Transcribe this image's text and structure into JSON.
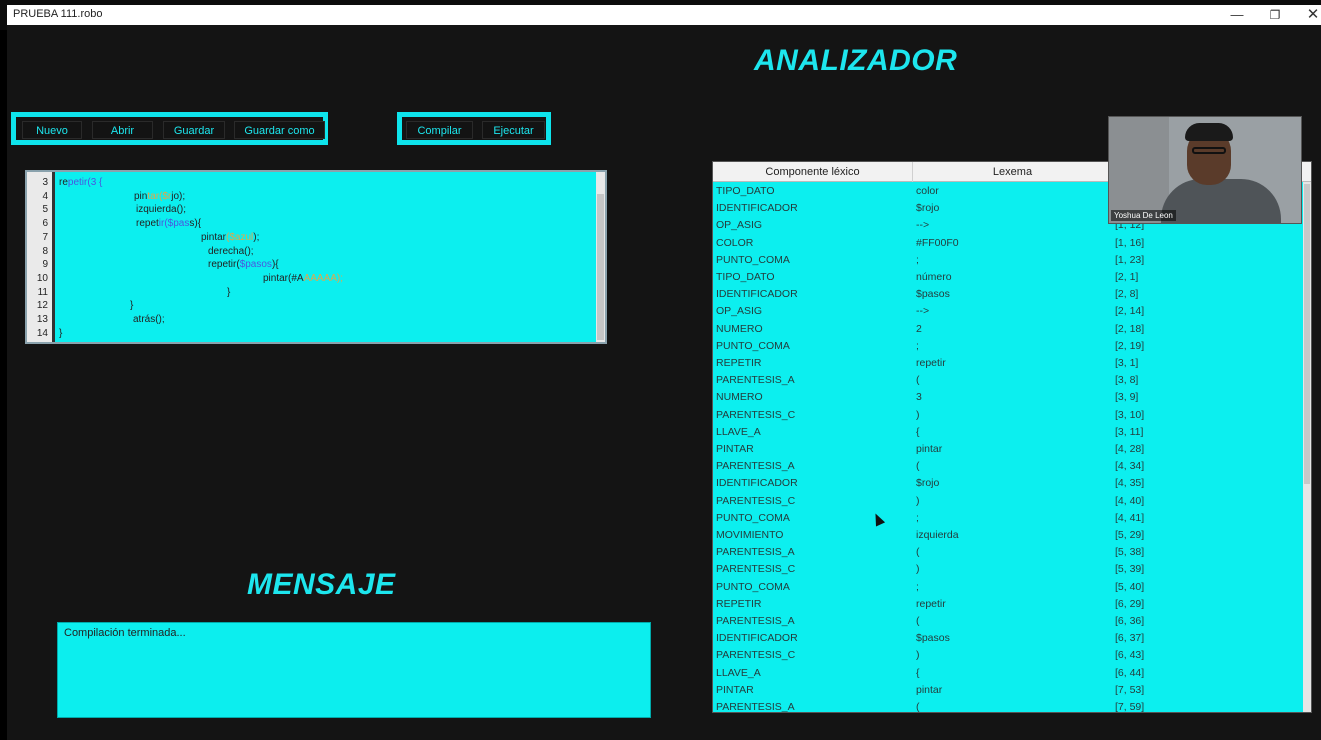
{
  "window": {
    "title": "PRUEBA 111.robo",
    "minimize": "—",
    "maximize": "❐",
    "close": "✕"
  },
  "headings": {
    "analizador": "ANALIZADOR",
    "mensaje": "MENSAJE"
  },
  "toolbar": {
    "nuevo": "Nuevo",
    "abrir": "Abrir",
    "guardar": "Guardar",
    "guardar_como": "Guardar como",
    "compilar": "Compilar",
    "ejecutar": "Ejecutar"
  },
  "editor": {
    "line_numbers": [
      "3",
      "4",
      "5",
      "6",
      "7",
      "8",
      "9",
      "10",
      "11",
      "12",
      "13",
      "14"
    ],
    "lines": [
      [
        {
          "t": "re",
          "c": ""
        },
        {
          "t": "petir(3 {",
          "c": "kw"
        }
      ],
      [
        {
          "t": "pin",
          "c": ""
        },
        {
          "t": "tar($r",
          "c": "var"
        },
        {
          "t": "jo);",
          "c": ""
        }
      ],
      [
        {
          "t": "izquierda();",
          "c": ""
        }
      ],
      [
        {
          "t": "repet",
          "c": ""
        },
        {
          "t": "ir($pas",
          "c": "kw"
        },
        {
          "t": "s){",
          "c": ""
        }
      ],
      [
        {
          "t": "pintar",
          "c": ""
        },
        {
          "t": "($azul",
          "c": "var"
        },
        {
          "t": ");",
          "c": ""
        }
      ],
      [
        {
          "t": "derecha();",
          "c": ""
        }
      ],
      [
        {
          "t": "repetir(",
          "c": ""
        },
        {
          "t": "$pasos",
          "c": "kw"
        },
        {
          "t": "){",
          "c": ""
        }
      ],
      [
        {
          "t": "pintar(#A",
          "c": ""
        },
        {
          "t": "AAAAA);",
          "c": "var"
        }
      ],
      [
        {
          "t": "}",
          "c": ""
        }
      ],
      [
        {
          "t": "}",
          "c": ""
        }
      ],
      [
        {
          "t": "atrás();",
          "c": ""
        }
      ],
      [
        {
          "t": "}",
          "c": ""
        }
      ]
    ]
  },
  "message": {
    "text": "Compilación terminada..."
  },
  "table": {
    "headers": [
      "Componente léxico",
      "Lexema",
      ""
    ],
    "rows": [
      [
        "TIPO_DATO",
        "color",
        "[1, 1]"
      ],
      [
        "IDENTIFICADOR",
        "$rojo",
        "[1, 7]"
      ],
      [
        "OP_ASIG",
        "-->",
        "[1, 12]"
      ],
      [
        "COLOR",
        "#FF00F0",
        "[1, 16]"
      ],
      [
        "PUNTO_COMA",
        ";",
        "[1, 23]"
      ],
      [
        "TIPO_DATO",
        "número",
        "[2, 1]"
      ],
      [
        "IDENTIFICADOR",
        "$pasos",
        "[2, 8]"
      ],
      [
        "OP_ASIG",
        "-->",
        "[2, 14]"
      ],
      [
        "NUMERO",
        "2",
        "[2, 18]"
      ],
      [
        "PUNTO_COMA",
        ";",
        "[2, 19]"
      ],
      [
        "REPETIR",
        "repetir",
        "[3, 1]"
      ],
      [
        "PARENTESIS_A",
        "(",
        "[3, 8]"
      ],
      [
        "NUMERO",
        "3",
        "[3, 9]"
      ],
      [
        "PARENTESIS_C",
        ")",
        "[3, 10]"
      ],
      [
        "LLAVE_A",
        "{",
        "[3, 11]"
      ],
      [
        "PINTAR",
        "pintar",
        "[4, 28]"
      ],
      [
        "PARENTESIS_A",
        "(",
        "[4, 34]"
      ],
      [
        "IDENTIFICADOR",
        "$rojo",
        "[4, 35]"
      ],
      [
        "PARENTESIS_C",
        ")",
        "[4, 40]"
      ],
      [
        "PUNTO_COMA",
        ";",
        "[4, 41]"
      ],
      [
        "MOVIMIENTO",
        "izquierda",
        "[5, 29]"
      ],
      [
        "PARENTESIS_A",
        "(",
        "[5, 38]"
      ],
      [
        "PARENTESIS_C",
        ")",
        "[5, 39]"
      ],
      [
        "PUNTO_COMA",
        ";",
        "[5, 40]"
      ],
      [
        "REPETIR",
        "repetir",
        "[6, 29]"
      ],
      [
        "PARENTESIS_A",
        "(",
        "[6, 36]"
      ],
      [
        "IDENTIFICADOR",
        "$pasos",
        "[6, 37]"
      ],
      [
        "PARENTESIS_C",
        ")",
        "[6, 43]"
      ],
      [
        "LLAVE_A",
        "{",
        "[6, 44]"
      ],
      [
        "PINTAR",
        "pintar",
        "[7, 53]"
      ],
      [
        "PARENTESIS_A",
        "(",
        "[7, 59]"
      ]
    ]
  },
  "webcam": {
    "name": "Yoshua De  Leon"
  },
  "colors": {
    "accent": "#0ceeee",
    "background": "#141414",
    "heading": "#1de6ee"
  }
}
